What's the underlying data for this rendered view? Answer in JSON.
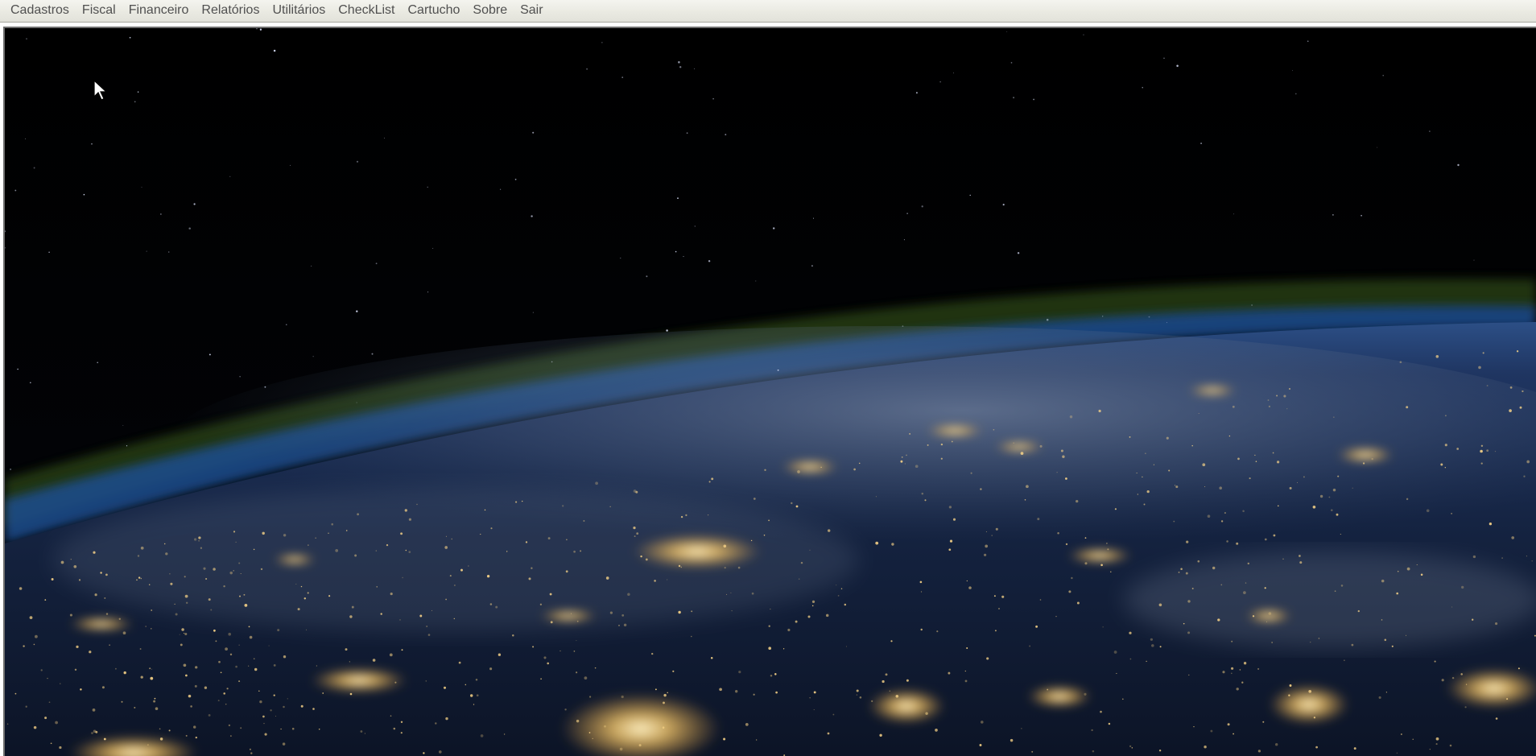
{
  "menubar": {
    "items": [
      {
        "label": "Cadastros"
      },
      {
        "label": "Fiscal"
      },
      {
        "label": "Financeiro"
      },
      {
        "label": "Relatórios"
      },
      {
        "label": "Utilitários"
      },
      {
        "label": "CheckList"
      },
      {
        "label": "Cartucho"
      },
      {
        "label": "Sobre"
      },
      {
        "label": "Sair"
      }
    ]
  },
  "background": {
    "icon": "earth-at-night-wallpaper",
    "space_color": "#000000",
    "atmosphere_color": "#2f4a16",
    "ocean_color": "#1a2a4a",
    "city_light_color": "#f6c86a"
  },
  "cursor": {
    "icon": "arrow-cursor-icon"
  }
}
